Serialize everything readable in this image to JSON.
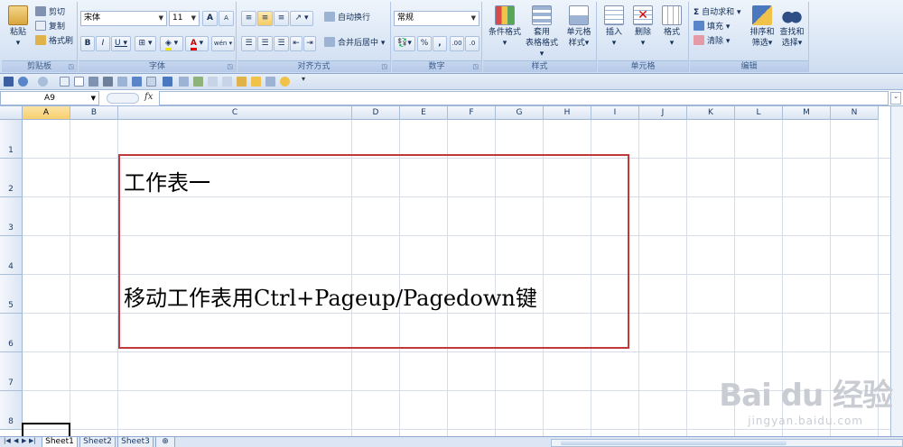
{
  "ribbon": {
    "clipboard": {
      "group_label": "剪贴板",
      "paste": "粘贴",
      "cut": "剪切",
      "copy": "复制",
      "format_painter": "格式刷"
    },
    "font": {
      "group_label": "字体",
      "font_name": "宋体",
      "font_size": "11",
      "bold": "B",
      "italic": "I",
      "underline": "U",
      "font_color_glyph": "A",
      "grow": "A",
      "shrink": "A",
      "phonetic": "wén"
    },
    "alignment": {
      "group_label": "对齐方式",
      "wrap_text": "自动换行",
      "merge_center": "合并后居中"
    },
    "number": {
      "group_label": "数字",
      "format": "常规",
      "percent": "%",
      "comma": ",",
      "inc_decimal": ".00",
      "dec_decimal": ".0"
    },
    "styles": {
      "group_label": "样式",
      "conditional": [
        "条件格式"
      ],
      "table_format": [
        "套用",
        "表格格式"
      ],
      "cell_styles": [
        "单元格",
        "样式"
      ]
    },
    "cells": {
      "group_label": "单元格",
      "insert": "插入",
      "delete": "删除",
      "format": "格式"
    },
    "editing": {
      "group_label": "编辑",
      "autosum": "自动求和",
      "fill": "填充",
      "clear": "清除",
      "sort_filter": [
        "排序和",
        "筛选"
      ],
      "find_select": [
        "查找和",
        "选择"
      ]
    }
  },
  "formula_bar": {
    "name_box": "A9",
    "fx": "fx",
    "value": ""
  },
  "grid": {
    "columns": [
      "A",
      "B",
      "C",
      "D",
      "E",
      "F",
      "G",
      "H",
      "I",
      "J",
      "K",
      "L",
      "M",
      "N"
    ],
    "rows": [
      "1",
      "2",
      "3",
      "4",
      "5",
      "6",
      "7",
      "8"
    ],
    "selected_column": "A",
    "active_cell": "A9"
  },
  "cells": {
    "c2": "工作表一",
    "c5": "移动工作表用Ctrl+Pageup/Pagedown键"
  },
  "sheet_tabs": [
    "Sheet1",
    "Sheet2",
    "Sheet3"
  ],
  "active_sheet": "Sheet1",
  "watermark": {
    "brand": "Bai du 经验",
    "url": "jingyan.baidu.com"
  },
  "colors": {
    "ribbon_bg": "#dde8f6",
    "highlight_box": "#c0393b",
    "selected_header": "#f8cf6e"
  }
}
